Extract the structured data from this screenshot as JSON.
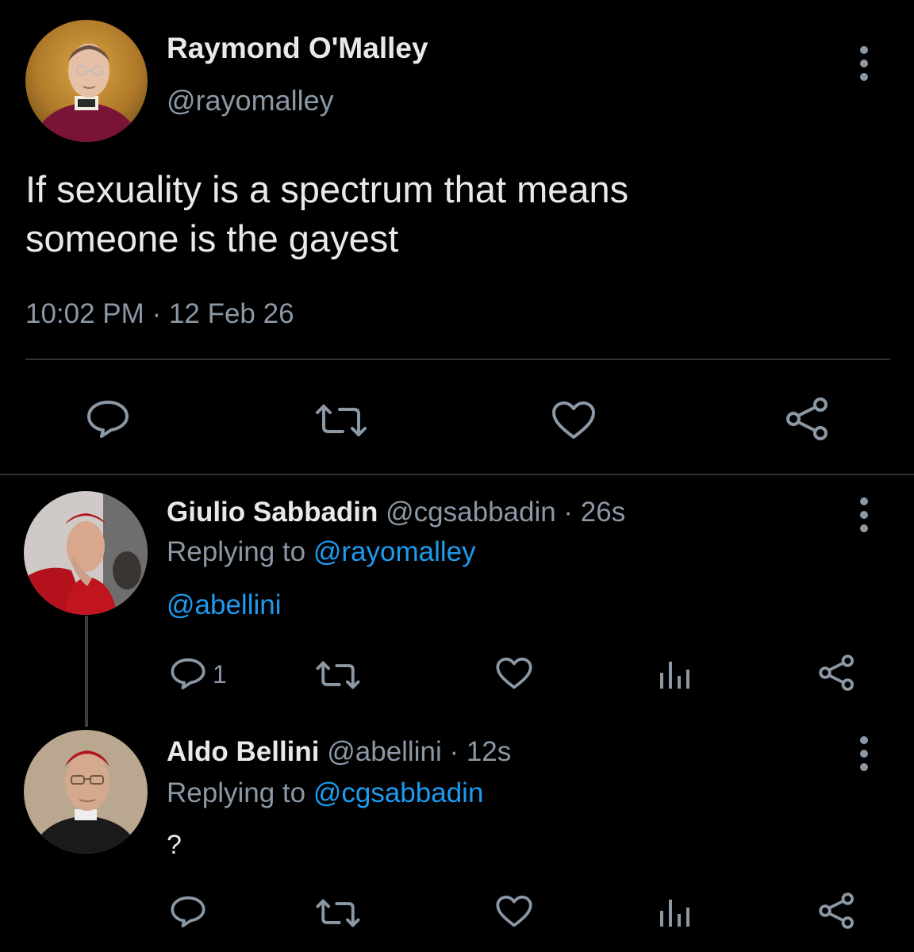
{
  "main_tweet": {
    "author_name": "Raymond O'Malley",
    "handle": "@rayomalley",
    "text_line1": "If sexuality is a spectrum that means",
    "text_line2": "someone is the gayest",
    "timestamp": "10:02 PM · 12 Feb 26",
    "actions": [
      "reply-icon",
      "retweet-icon",
      "like-icon",
      "share-icon"
    ]
  },
  "replies": [
    {
      "author_name": "Giulio Sabbadin",
      "meta": "@cgsabbadin · 26s",
      "replying_prefix": "Replying to",
      "replying_handle": "@rayomalley",
      "body": "@abellini",
      "reply_count": "1",
      "actions": [
        "reply-icon",
        "retweet-icon",
        "like-icon",
        "analytics-icon",
        "share-icon"
      ]
    },
    {
      "author_name": "Aldo Bellini",
      "meta": "@abellini · 12s",
      "replying_prefix": "Replying to",
      "replying_handle": "@cgsabbadin",
      "body": "?",
      "reply_count": "",
      "actions": [
        "reply-icon",
        "retweet-icon",
        "like-icon",
        "analytics-icon",
        "share-icon"
      ]
    }
  ],
  "colors": {
    "background": "#000000",
    "text": "#e7e9ea",
    "secondary": "#8b98a5",
    "link": "#1d9bf0",
    "divider": "#2f3336"
  }
}
